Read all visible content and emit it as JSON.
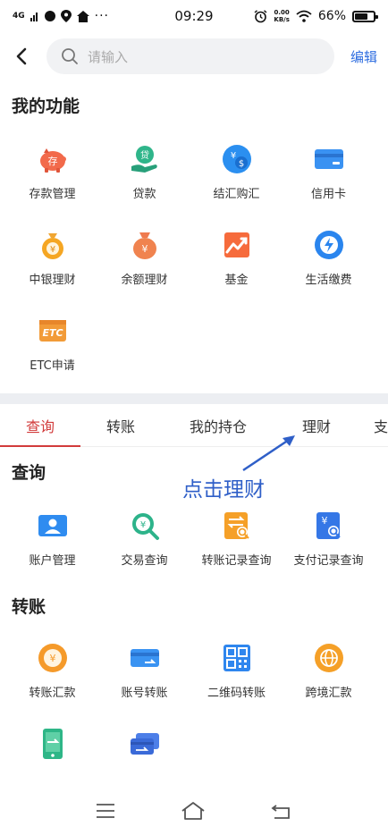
{
  "status_bar": {
    "signal": "4G",
    "time": "09:29",
    "speed_value": "0.00",
    "speed_unit": "KB/s",
    "battery": "66%"
  },
  "search": {
    "placeholder": "请输入",
    "edit_label": "编辑"
  },
  "my_functions": {
    "title": "我的功能",
    "items": [
      {
        "label": "存款管理",
        "icon": "piggy-bank-icon"
      },
      {
        "label": "贷款",
        "icon": "loan-icon"
      },
      {
        "label": "结汇购汇",
        "icon": "currency-exchange-icon"
      },
      {
        "label": "信用卡",
        "icon": "credit-card-icon"
      },
      {
        "label": "中银理财",
        "icon": "money-bag-icon"
      },
      {
        "label": "余额理财",
        "icon": "balance-bag-icon"
      },
      {
        "label": "基金",
        "icon": "fund-chart-icon"
      },
      {
        "label": "生活缴费",
        "icon": "bolt-icon"
      },
      {
        "label": "ETC申请",
        "icon": "etc-icon"
      }
    ]
  },
  "tabs": [
    {
      "label": "查询",
      "active": true
    },
    {
      "label": "转账",
      "active": false
    },
    {
      "label": "我的持仓",
      "active": false
    },
    {
      "label": "理财",
      "active": false
    },
    {
      "label": "支",
      "active": false
    }
  ],
  "annotation": "点击理财",
  "query_section": {
    "title": "查询",
    "items": [
      {
        "label": "账户管理",
        "icon": "account-icon"
      },
      {
        "label": "交易查询",
        "icon": "transaction-search-icon"
      },
      {
        "label": "转账记录查询",
        "icon": "transfer-record-icon"
      },
      {
        "label": "支付记录查询",
        "icon": "payment-record-icon"
      }
    ]
  },
  "transfer_section": {
    "title": "转账",
    "items": [
      {
        "label": "转账汇款",
        "icon": "remittance-icon"
      },
      {
        "label": "账号转账",
        "icon": "account-transfer-icon"
      },
      {
        "label": "二维码转账",
        "icon": "qr-code-icon"
      },
      {
        "label": "跨境汇款",
        "icon": "globe-icon"
      },
      {
        "label": "",
        "icon": "phone-transfer-icon"
      },
      {
        "label": "",
        "icon": "card-transfer-icon"
      }
    ]
  },
  "colors": {
    "accent_red": "#d23b3b",
    "link_blue": "#2f6ee0",
    "annotation_blue": "#2f5fc8"
  }
}
